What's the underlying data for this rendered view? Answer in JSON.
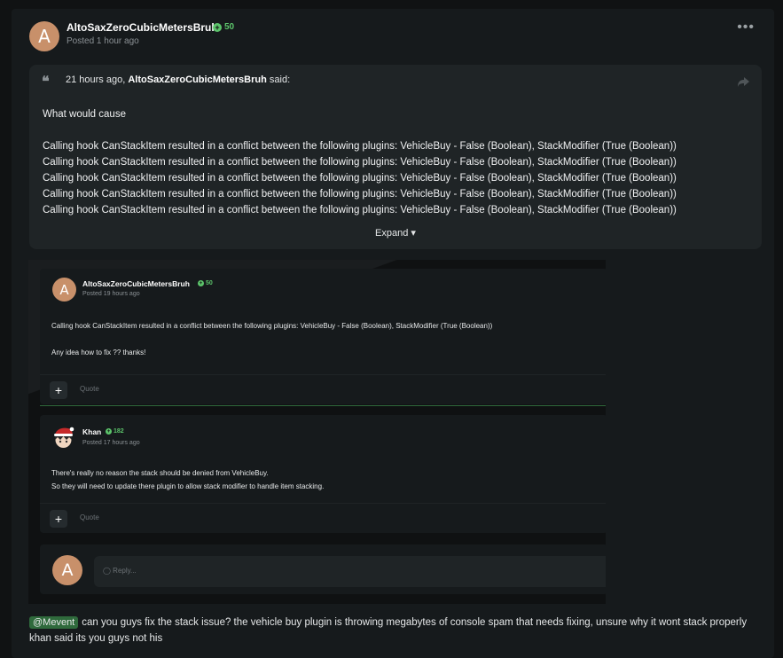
{
  "post": {
    "avatar_letter": "A",
    "author": "AltoSaxZeroCubicMetersBruh",
    "reputation": "50",
    "posted": "Posted 1 hour ago",
    "more_label": "•••"
  },
  "quote": {
    "mark": "❝",
    "time": "21 hours ago,",
    "author": "AltoSaxZeroCubicMetersBruh",
    "said": "said:",
    "lines": [
      "What would cause",
      "",
      "Calling hook CanStackItem resulted in a conflict between the following plugins: VehicleBuy - False (Boolean), StackModifier (True (Boolean))",
      "Calling hook CanStackItem resulted in a conflict between the following plugins: VehicleBuy - False (Boolean), StackModifier (True (Boolean))",
      "Calling hook CanStackItem resulted in a conflict between the following plugins: VehicleBuy - False (Boolean), StackModifier (True (Boolean))",
      "Calling hook CanStackItem resulted in a conflict between the following plugins: VehicleBuy - False (Boolean), StackModifier (True (Boolean))",
      "Calling hook CanStackItem resulted in a conflict between the following plugins: VehicleBuy - False (Boolean), StackModifier (True (Boolean))"
    ],
    "expand": "Expand ▾"
  },
  "screenshot": {
    "first": {
      "avatar_letter": "A",
      "author": "AltoSaxZeroCubicMetersBruh",
      "reputation": "50",
      "posted": "Posted 19 hours ago",
      "lines": [
        "Calling hook CanStackItem resulted in a conflict between the following plugins: VehicleBuy - False (Boolean), StackModifier (True (Boolean))",
        "",
        "Any idea how to fix ?? thanks!"
      ],
      "quote_label": "Quote"
    },
    "second": {
      "author": "Khan",
      "reputation": "182",
      "posted": "Posted 17 hours ago",
      "lines": [
        "There's really no reason the stack should be denied from VehicleBuy.",
        "So they will need to update there plugin to allow stack modifier to handle item stacking."
      ],
      "quote_label": "Quote"
    },
    "reply": {
      "avatar_letter": "A",
      "placeholder": "◯ Reply..."
    }
  },
  "message": {
    "mention": "@Mevent",
    "line1": "can you guys fix the stack issue? the vehicle buy plugin is throwing megabytes of console spam that needs fixing, unsure why it wont stack properly",
    "line2": "khan said its you guys not his"
  },
  "colors": {
    "background": "#101213",
    "card": "#161a1c",
    "quote_bg": "#1f2426",
    "accent_green": "#5cc46b",
    "mention_bg": "#2f6a3c",
    "avatar": "#c8906a"
  }
}
